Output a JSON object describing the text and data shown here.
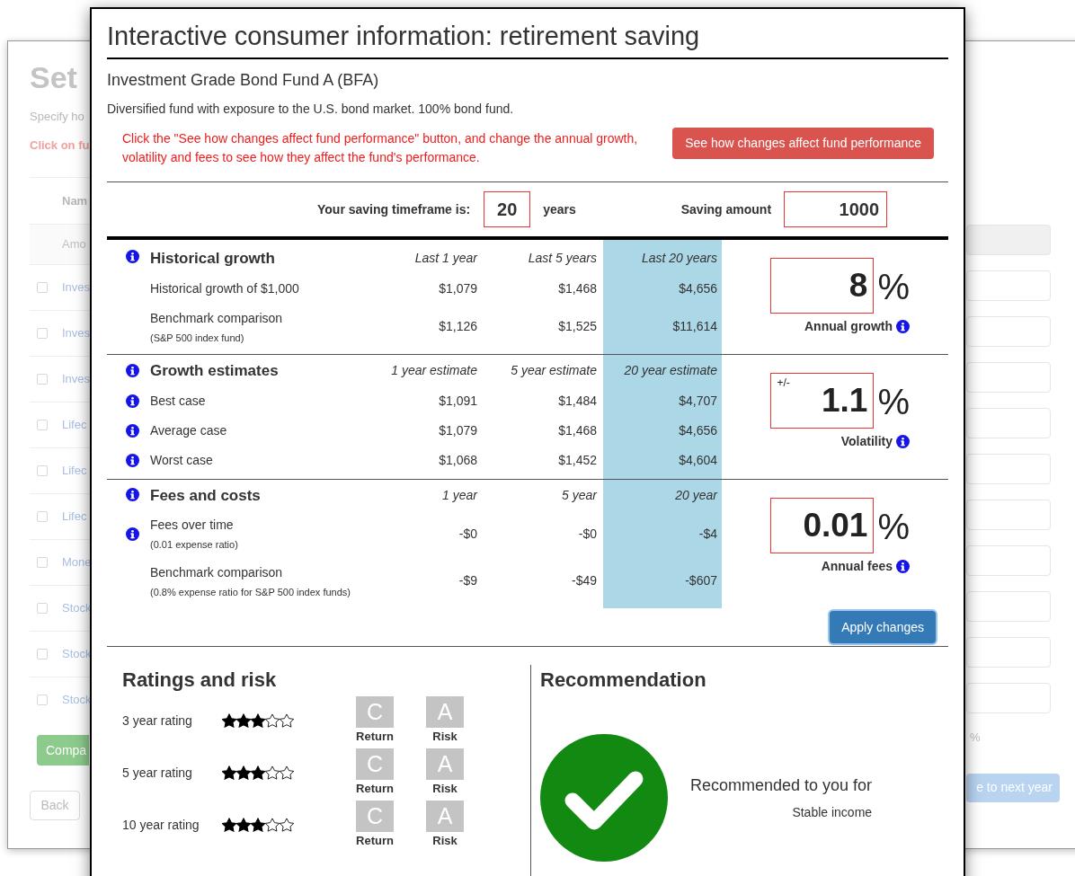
{
  "background_page": {
    "title": "Set",
    "subtitle": "Specify ho",
    "instruction": "Click on fu",
    "column_header": "Nam",
    "amount_row": "Amo",
    "rows": [
      {
        "label": "Inves",
        "checked": false
      },
      {
        "label": "Inves",
        "checked": false
      },
      {
        "label": "Inves",
        "checked": false
      },
      {
        "label": "Lifec",
        "checked": false
      },
      {
        "label": "Lifec",
        "checked": false
      },
      {
        "label": "Lifec",
        "checked": false
      },
      {
        "label": "Mone",
        "checked": false
      },
      {
        "label": "Stock",
        "checked": false
      },
      {
        "label": "Stock",
        "checked": false
      },
      {
        "label": "Stock",
        "checked": false
      }
    ],
    "compare_button": "Compa",
    "back_button": "Back",
    "percent": "%",
    "next_button": "e to next year"
  },
  "modal": {
    "title": "Interactive consumer information: retirement saving",
    "fund_name": "Investment Grade Bond Fund A (BFA)",
    "description": "Diversified fund with exposure to the U.S. bond market. 100% bond fund.",
    "instruction": "Click the \"See how changes affect fund performance\" button, and change the annual growth, volatility and fees to see how they affect the fund's performance.",
    "performance_button": "See how changes affect fund performance",
    "timeframe": {
      "label": "Your saving timeframe is:",
      "value": "20",
      "unit": "years"
    },
    "saving_amount": {
      "label": "Saving amount",
      "value": "1000"
    },
    "sections": [
      {
        "title": "Historical growth",
        "info": true,
        "columns": [
          {
            "label": "Last 1 year",
            "highlighted": false
          },
          {
            "label": "Last 5 years",
            "highlighted": false
          },
          {
            "label": "Last 20 years",
            "highlighted": true
          }
        ],
        "rows": [
          {
            "label": "Historical growth of $1,000",
            "info": false,
            "values": [
              "$1,079",
              "$1,468",
              "$4,656"
            ]
          },
          {
            "label": "Benchmark comparison",
            "note": "(S&P 500 index fund)",
            "info": false,
            "values": [
              "$1,126",
              "$1,525",
              "$11,614"
            ]
          }
        ],
        "setting": {
          "value": "8",
          "unit": "%",
          "label": "Annual growth"
        }
      },
      {
        "title": "Growth estimates",
        "info": true,
        "columns": [
          {
            "label": "1 year estimate",
            "highlighted": false
          },
          {
            "label": "5 year estimate",
            "highlighted": false
          },
          {
            "label": "20 year estimate",
            "highlighted": true
          }
        ],
        "rows": [
          {
            "label": "Best case",
            "info": true,
            "values": [
              "$1,091",
              "$1,484",
              "$4,707"
            ]
          },
          {
            "label": "Average case",
            "info": true,
            "values": [
              "$1,079",
              "$1,468",
              "$4,656"
            ]
          },
          {
            "label": "Worst case",
            "info": true,
            "values": [
              "$1,068",
              "$1,452",
              "$4,604"
            ]
          }
        ],
        "setting": {
          "prefix": "+/-",
          "value": "1.1",
          "unit": "%",
          "label": "Volatility"
        }
      },
      {
        "title": "Fees and costs",
        "info": true,
        "columns": [
          {
            "label": "1 year",
            "highlighted": false
          },
          {
            "label": "5 year",
            "highlighted": false
          },
          {
            "label": "20 year",
            "highlighted": true
          }
        ],
        "rows": [
          {
            "label": "Fees over time",
            "note": "(0.01 expense ratio)",
            "info": true,
            "values": [
              "-$0",
              "-$0",
              "-$4"
            ]
          },
          {
            "label": "Benchmark comparison",
            "note": "(0.8% expense ratio for S&P 500 index funds)",
            "info": false,
            "values": [
              "-$9",
              "-$49",
              "-$607"
            ]
          }
        ],
        "setting": {
          "value": "0.01",
          "unit": "%",
          "label": "Annual fees"
        }
      }
    ],
    "apply_button": "Apply changes",
    "ratings": {
      "title": "Ratings and risk",
      "rows": [
        {
          "label": "3 year rating",
          "stars": 3,
          "return_grade": "C",
          "return_label": "Return",
          "risk_grade": "A",
          "risk_label": "Risk"
        },
        {
          "label": "5 year rating",
          "stars": 3,
          "return_grade": "C",
          "return_label": "Return",
          "risk_grade": "A",
          "risk_label": "Risk"
        },
        {
          "label": "10 year rating",
          "stars": 3,
          "return_grade": "C",
          "return_label": "Return",
          "risk_grade": "A",
          "risk_label": "Risk"
        }
      ]
    },
    "recommendation": {
      "title": "Recommendation",
      "recommended": true,
      "text": "Recommended to you for",
      "goal": "Stable income"
    }
  }
}
